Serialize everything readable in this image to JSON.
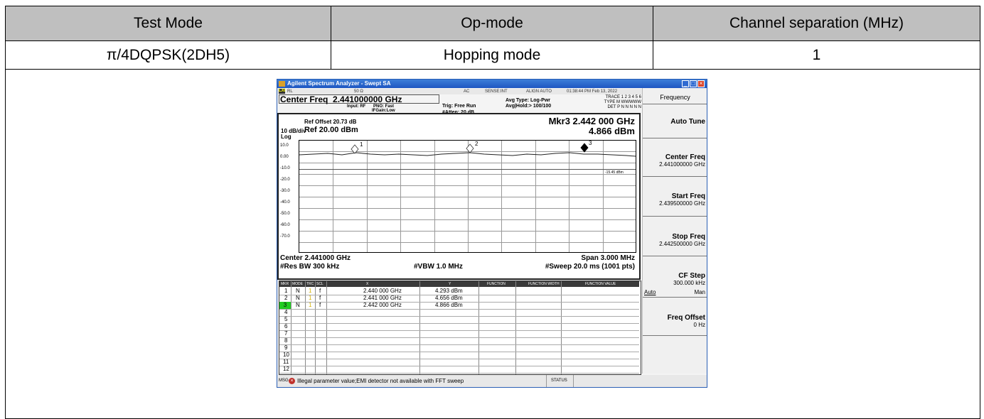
{
  "table": {
    "headers": [
      "Test Mode",
      "Op-mode",
      "Channel separation (MHz)"
    ],
    "row": [
      "π/4DQPSK(2DH5)",
      "Hopping mode",
      "1"
    ]
  },
  "analyzer": {
    "title": "Agilent Spectrum Analyzer - Swept SA",
    "status": {
      "rl": "RL",
      "impedance": "50 Ω",
      "ac": "AC",
      "sense": "SENSE:INT",
      "align": "ALIGN AUTO",
      "datetime": "01:38:44 PM Feb 13, 2022"
    },
    "center_freq_label": "Center Freq",
    "center_freq_value": "2.441000000 GHz",
    "input": "Input: RF",
    "pno": "PNO: Fast",
    "ifgain": "IFGain:Low",
    "trig": "Trig: Free Run",
    "atten": "#Atten: 20 dB",
    "avg_type": "Avg Type: Log-Pwr",
    "avg_hold": "Avg|Hold:> 100/100",
    "trace_row": "TRACE 1 2 3 4 5 6",
    "type_row": "TYPE M WWWWW",
    "det_row": "DET P N N N N N",
    "ref_offset": "Ref Offset 20.73 dB",
    "ref_level": "Ref 20.00 dBm",
    "scale": "10 dB/div",
    "log": "Log",
    "marker_readout": "Mkr3 2.442 000 GHz",
    "marker_value": "4.866 dBm",
    "y_ticks": [
      "10.0",
      "0.00",
      "-10.0",
      "-20.0",
      "-30.0",
      "-40.0",
      "-50.0",
      "-60.0",
      "-70.0"
    ],
    "display_line": "-15.45 dBm",
    "center_bottom": "Center 2.441000 GHz",
    "res_bw": "#Res BW 300 kHz",
    "vbw": "#VBW 1.0 MHz",
    "span": "Span 3.000 MHz",
    "sweep": "#Sweep  20.0 ms (1001 pts)",
    "marker_labels": [
      "1",
      "2",
      "3"
    ],
    "mkr_table_headers": [
      "MKR",
      "MODE",
      "TRC",
      "SCL",
      "X",
      "Y",
      "FUNCTION",
      "FUNCTION WIDTH",
      "FUNCTION VALUE"
    ],
    "markers": [
      {
        "n": "1",
        "mode": "N",
        "trc": "1",
        "scl": "f",
        "x": "2.440 000 GHz",
        "y": "4.293 dBm"
      },
      {
        "n": "2",
        "mode": "N",
        "trc": "1",
        "scl": "f",
        "x": "2.441 000 GHz",
        "y": "4.656 dBm"
      },
      {
        "n": "3",
        "mode": "N",
        "trc": "1",
        "scl": "f",
        "x": "2.442 000 GHz",
        "y": "4.866 dBm"
      }
    ],
    "empty_rows": [
      "4",
      "5",
      "6",
      "7",
      "8",
      "9",
      "10",
      "11",
      "12"
    ],
    "msg_label": "MSG",
    "msg_text": "Illegal parameter value;EMI detector not available with FFT sweep",
    "status_label": "STATUS",
    "softkeys": {
      "menu": "Frequency",
      "auto_tune": "Auto Tune",
      "center_freq": "Center Freq",
      "center_freq_val": "2.441000000 GHz",
      "start_freq": "Start Freq",
      "start_freq_val": "2.439500000 GHz",
      "stop_freq": "Stop Freq",
      "stop_freq_val": "2.442500000 GHz",
      "cf_step": "CF Step",
      "cf_step_val": "300.000 kHz",
      "cf_auto": "Auto",
      "cf_man": "Man",
      "freq_offset": "Freq Offset",
      "freq_offset_val": "0 Hz"
    }
  }
}
